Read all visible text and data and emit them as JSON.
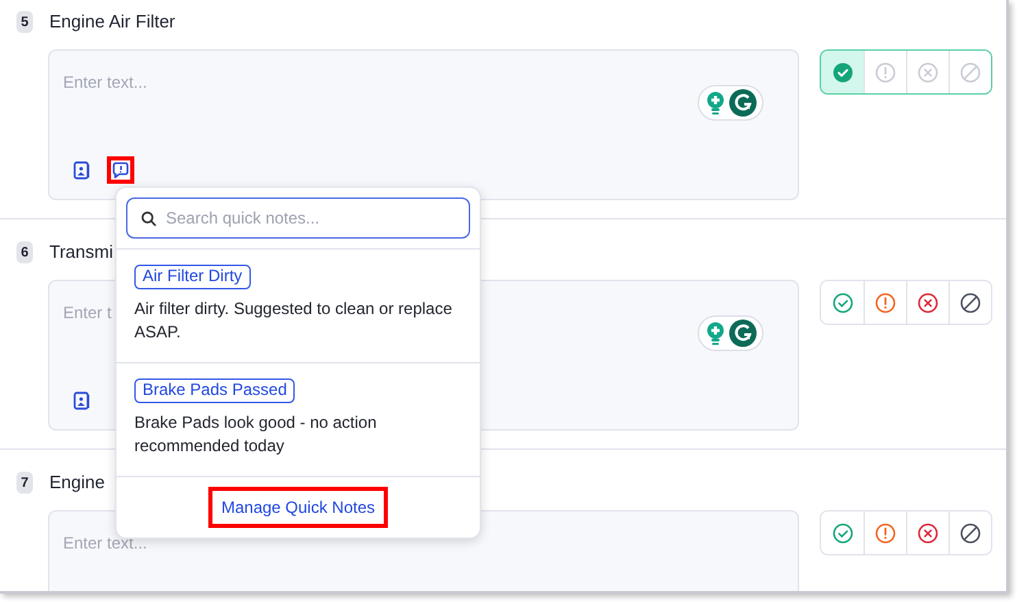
{
  "items": [
    {
      "number": "5",
      "title": "Engine Air Filter",
      "field": {
        "placeholder": "Enter text...",
        "tools": [
          {
            "kind": "photo"
          },
          {
            "kind": "quick_note",
            "highlighted": true
          },
          {
            "kind": "assistant"
          }
        ]
      },
      "statuses": [
        {
          "kind": "pass",
          "selected": true
        },
        {
          "kind": "warning",
          "selected": false
        },
        {
          "kind": "fail",
          "selected": false
        },
        {
          "kind": "not_applicable",
          "selected": false
        }
      ]
    },
    {
      "number": "6",
      "title": "Transmi",
      "field": {
        "placeholder": "Enter t",
        "tools": [
          {
            "kind": "photo"
          },
          {
            "kind": "assistant"
          }
        ]
      },
      "statuses": [
        {
          "kind": "pass",
          "selected": false
        },
        {
          "kind": "warning",
          "selected": false
        },
        {
          "kind": "fail",
          "selected": false
        },
        {
          "kind": "not_applicable",
          "selected": false
        }
      ]
    },
    {
      "number": "7",
      "title": "Engine",
      "field": {
        "placeholder": "Enter text..."
      },
      "statuses": [
        {
          "kind": "pass",
          "selected": false
        },
        {
          "kind": "warning",
          "selected": false
        },
        {
          "kind": "fail",
          "selected": false
        },
        {
          "kind": "not_applicable",
          "selected": false
        }
      ]
    }
  ],
  "quick_notes_popover": {
    "search": {
      "placeholder": "Search quick notes..."
    },
    "notes": [
      {
        "tag": "Air Filter Dirty",
        "text": "Air filter dirty. Suggested to clean or replace ASAP."
      },
      {
        "tag": "Brake Pads Passed",
        "text": "Brake Pads look good - no action recommended today"
      }
    ],
    "manage_link": {
      "label": "Manage Quick Notes",
      "highlighted": true
    }
  }
}
